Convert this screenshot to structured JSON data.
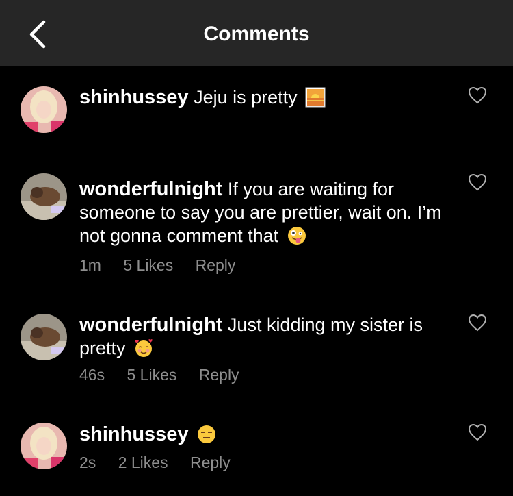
{
  "header": {
    "title": "Comments"
  },
  "comments": [
    {
      "username": "shinhussey",
      "text": "Jeju is pretty",
      "emoji": "sunset-emoji"
    },
    {
      "username": "wonderfulnight",
      "text": "If you are waiting for someone to say you are prettier, wait on. I’m not gonna comment that",
      "emoji": "zany-face-emoji",
      "time": "1m",
      "likes": "5 Likes",
      "reply": "Reply"
    },
    {
      "username": "wonderfulnight",
      "text": "Just kidding my sister is pretty",
      "emoji": "smiling-face-with-hearts-emoji",
      "time": "46s",
      "likes": "5 Likes",
      "reply": "Reply"
    },
    {
      "username": "shinhussey",
      "text": "",
      "emoji": "expressionless-face-emoji",
      "time": "2s",
      "likes": "2 Likes",
      "reply": "Reply"
    }
  ]
}
